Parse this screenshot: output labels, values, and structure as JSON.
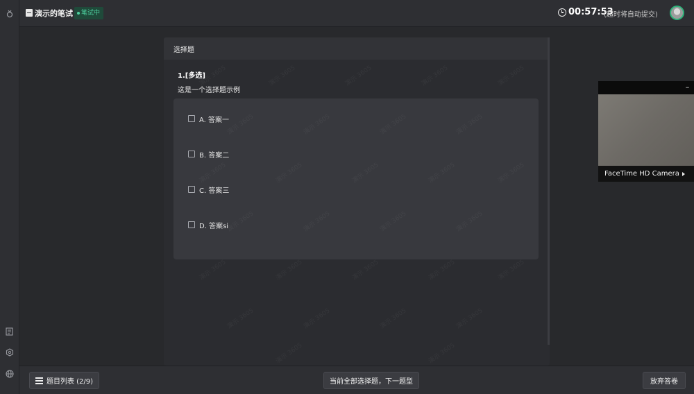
{
  "header": {
    "exam_title": "演示的笔试",
    "status_badge": "笔试中",
    "timer": "00:57:53",
    "timer_note": "(超时将自动提交)"
  },
  "section": {
    "title": "选择题"
  },
  "question": {
    "number": "1.[多选]",
    "text": "这是一个选择题示例",
    "options": [
      {
        "label": "A. 答案一",
        "checked": false
      },
      {
        "label": "B. 答案二",
        "checked": false
      },
      {
        "label": "C. 答案三",
        "checked": false
      },
      {
        "label": "D. 答案si",
        "checked": false
      }
    ]
  },
  "camera": {
    "name": "FaceTime HD Camera",
    "minimize": "–"
  },
  "footer": {
    "question_list": "题目列表 (2/9)",
    "next_type": "当前全部选择题，下一题型",
    "abandon": "放弃答卷"
  },
  "watermark_text": "演示 3605",
  "icons": {
    "rail_top": "tool-icon",
    "rail_notes": "notes-icon",
    "rail_settings": "hexagon-settings-icon",
    "rail_globe": "globe-icon"
  },
  "colors": {
    "accent_green": "#2fb37a",
    "badge_text": "#4fd1a0"
  }
}
